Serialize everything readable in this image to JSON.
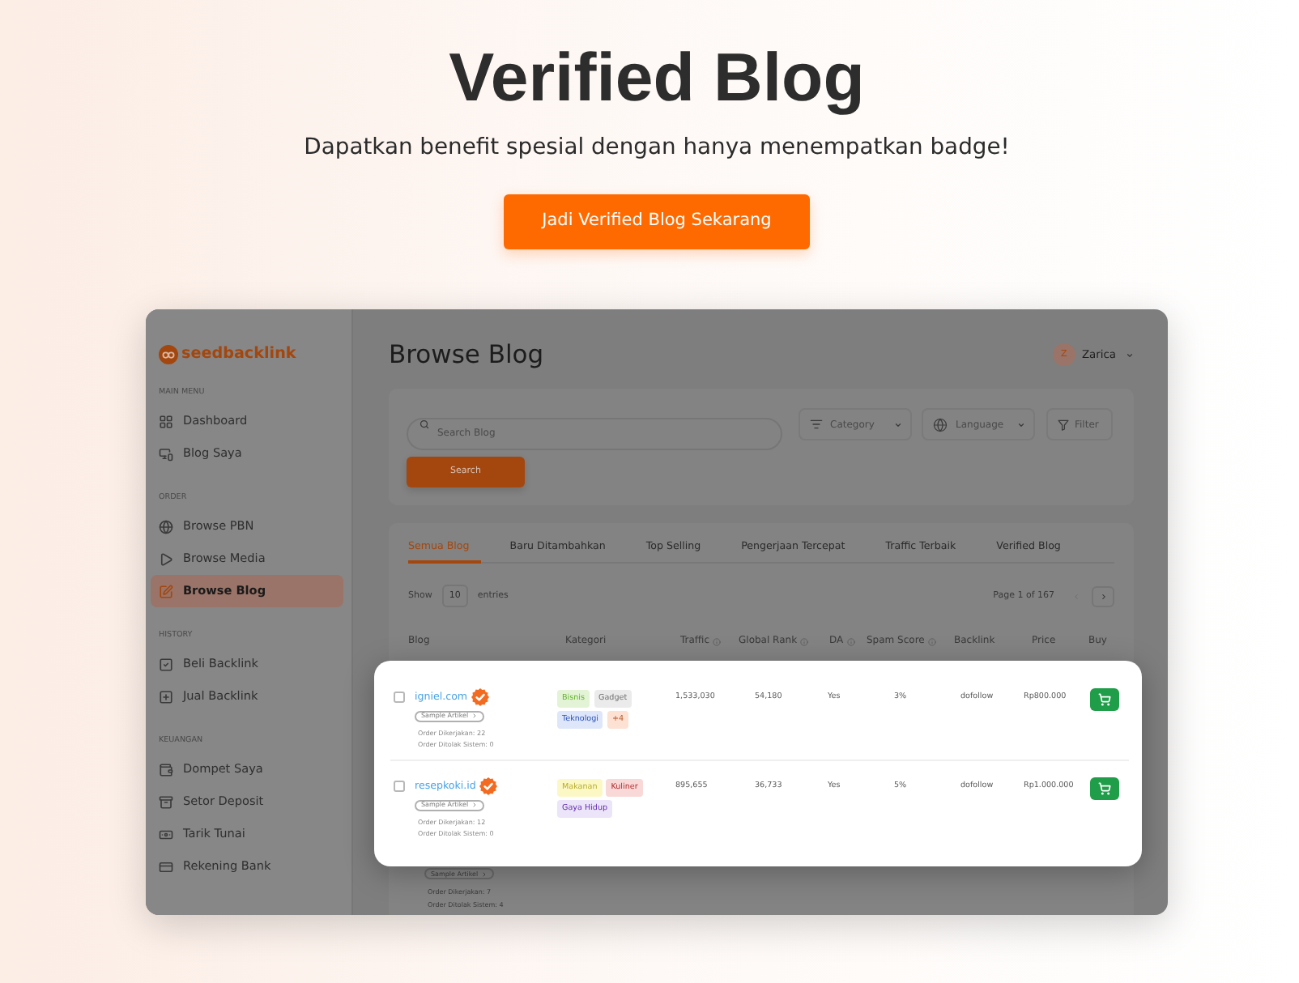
{
  "hero": {
    "title": "Verified Blog",
    "subtitle": "Dapatkan benefit spesial dengan hanya menempatkan badge!",
    "button": "Jadi Verified Blog Sekarang"
  },
  "app": {
    "sidebar": {
      "logo": "seedbacklink",
      "sections": [
        {
          "heading": "MAIN MENU",
          "items": [
            {
              "label": "Dashboard",
              "selected": false
            },
            {
              "label": "Blog Saya",
              "selected": false
            }
          ]
        },
        {
          "heading": "ORDER",
          "items": [
            {
              "label": "Browse PBN",
              "selected": false
            },
            {
              "label": "Browse Media",
              "selected": false
            },
            {
              "label": "Browse Blog",
              "selected": true
            }
          ]
        },
        {
          "heading": "HISTORY",
          "items": [
            {
              "label": "Beli Backlink",
              "selected": false
            },
            {
              "label": "Jual Backlink",
              "selected": false
            }
          ]
        },
        {
          "heading": "KEUANGAN",
          "items": [
            {
              "label": "Dompet Saya",
              "selected": false
            },
            {
              "label": "Setor Deposit",
              "selected": false
            },
            {
              "label": "Tarik Tunai",
              "selected": false
            },
            {
              "label": "Rekening Bank",
              "selected": false
            }
          ]
        }
      ]
    },
    "page_title": "Browse Blog",
    "user": {
      "initial": "Z",
      "name": "Zarica"
    },
    "search": {
      "placeholder": "Search Blog",
      "filters": [
        {
          "kind": "dropdown",
          "label": "Category"
        },
        {
          "kind": "dropdown",
          "label": "Language"
        },
        {
          "kind": "button",
          "label": "Filter"
        }
      ],
      "button": "Search"
    },
    "tabs": [
      {
        "label": "Semua Blog",
        "selected": true
      },
      {
        "label": "Baru Ditambahkan",
        "selected": false
      },
      {
        "label": "Top Selling",
        "selected": false
      },
      {
        "label": "Pengerjaan Tercepat",
        "selected": false
      },
      {
        "label": "Traffic Terbaik",
        "selected": false
      },
      {
        "label": "Verified Blog",
        "selected": false
      }
    ],
    "paging": {
      "show_label": "Show",
      "page_size": "10",
      "entries_label": "entries",
      "page_info": "Page 1 of 167"
    },
    "table": {
      "columns": [
        {
          "label": "Blog",
          "kind": "plain"
        },
        {
          "label": "Kategori",
          "kind": "plain"
        },
        {
          "label": "Traffic",
          "kind": "info"
        },
        {
          "label": "Global Rank",
          "kind": "info"
        },
        {
          "label": "DA",
          "kind": "info"
        },
        {
          "label": "Spam Score",
          "kind": "info"
        },
        {
          "label": "Backlink",
          "kind": "plain"
        },
        {
          "label": "Price",
          "kind": "plain"
        },
        {
          "label": "Buy",
          "kind": "plain"
        }
      ],
      "highlighted_rows": [
        {
          "checked": false,
          "blog": "igniel.com",
          "verified": true,
          "sample": "Sample Artikel",
          "orders": [
            "Order Dikerjakan: 22",
            "Order Ditolak Sistem: 0"
          ],
          "tags": [
            {
              "label": "Bisnis",
              "color": "#e2f4d5"
            },
            {
              "label": "Gadget",
              "color": "#ebebeb"
            },
            {
              "label": "Teknologi",
              "color": "#dee6fa"
            },
            {
              "label": "+4",
              "color": "#fde1d3"
            }
          ],
          "traffic": "1,533,030",
          "global_rank": "54,180",
          "da": "Yes",
          "spam_score": "3%",
          "backlink": "dofollow",
          "price": "Rp800.000"
        },
        {
          "checked": false,
          "blog": "resepkoki.id",
          "verified": true,
          "sample": "Sample Artikel",
          "orders": [
            "Order Dikerjakan: 12",
            "Order Ditolak Sistem: 0"
          ],
          "tags": [
            {
              "label": "Makanan",
              "color": "#fcf8c6"
            },
            {
              "label": "Kuliner",
              "color": "#f9d8d8"
            },
            {
              "label": "Gaya Hidup",
              "color": "#ece4f8"
            }
          ],
          "traffic": "895,655",
          "global_rank": "36,733",
          "da": "Yes",
          "spam_score": "5%",
          "backlink": "dofollow",
          "price": "Rp1.000.000"
        }
      ],
      "rows": [
        {
          "sample": "Sample Artikel",
          "orders": [
            "Order Dikerjakan: 7",
            "Order Ditolak Sistem: 4"
          ]
        }
      ]
    }
  }
}
